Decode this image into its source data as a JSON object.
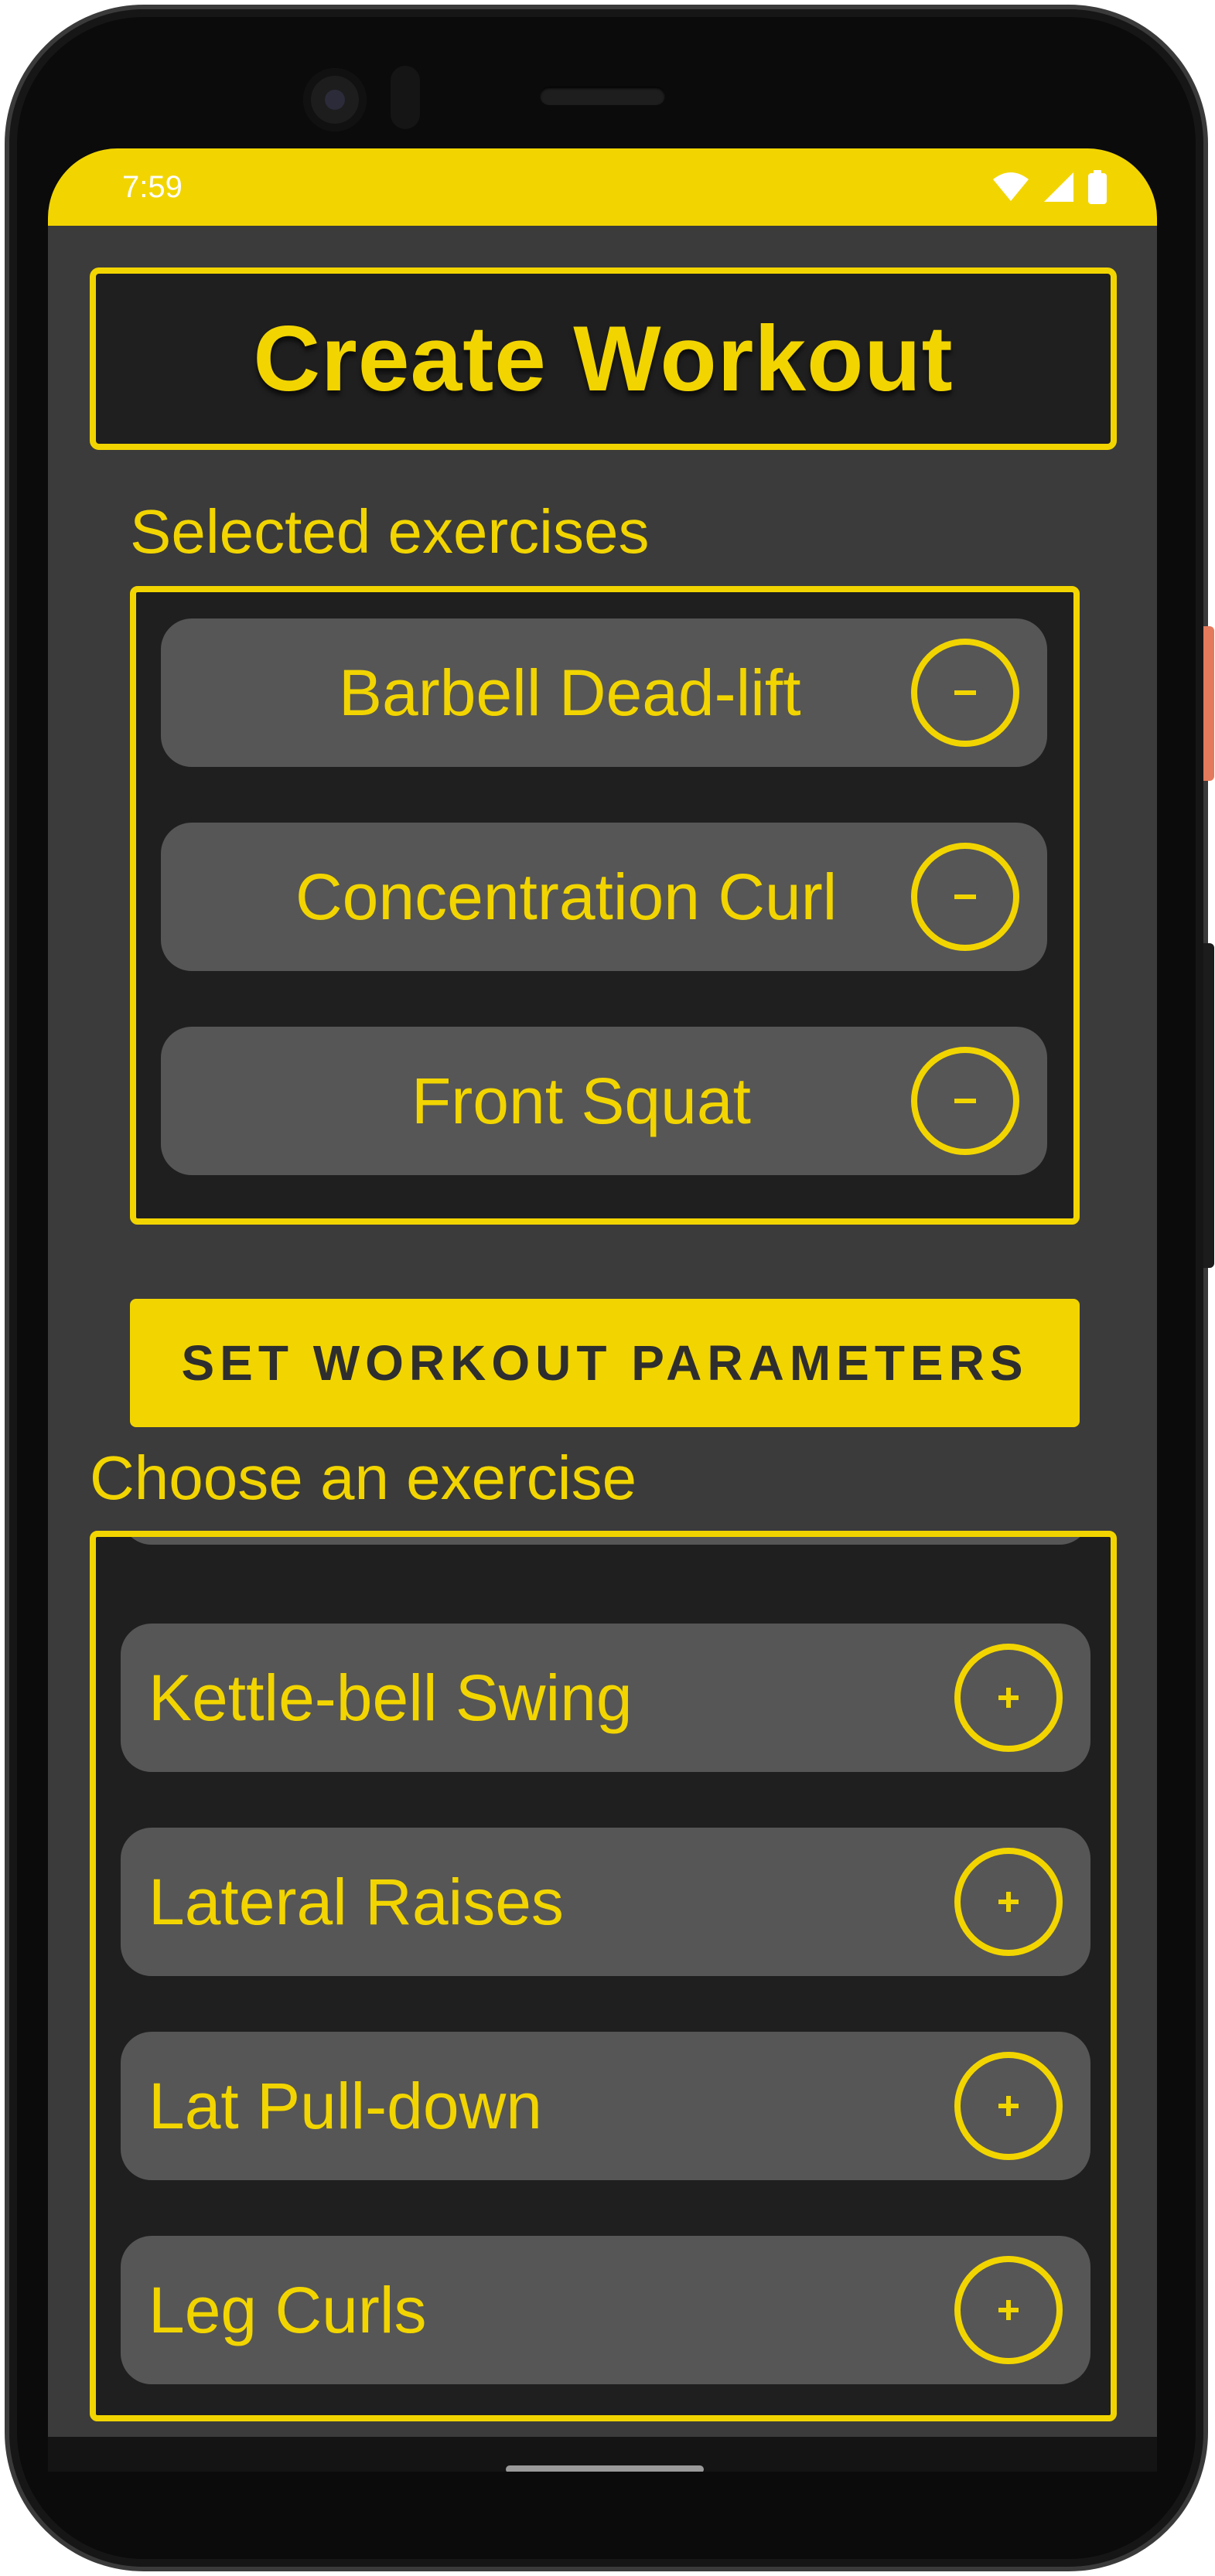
{
  "status_bar": {
    "time": "7:59",
    "icons": [
      "wifi-icon",
      "cellular-signal-icon",
      "battery-icon"
    ]
  },
  "header": {
    "title": "Create Workout"
  },
  "selected_section": {
    "label": "Selected exercises",
    "items": [
      {
        "label": "Barbell Dead-lift",
        "action_icon": "minus-icon"
      },
      {
        "label": "Concentration Curl",
        "action_icon": "minus-icon"
      },
      {
        "label": "Front Squat",
        "action_icon": "minus-icon"
      }
    ]
  },
  "set_parameters_button": {
    "label": "SET WORKOUT PARAMETERS"
  },
  "choose_section": {
    "label": "Choose an exercise",
    "items": [
      {
        "label": "Kettle-bell Swing",
        "action_icon": "plus-icon"
      },
      {
        "label": "Lateral Raises",
        "action_icon": "plus-icon"
      },
      {
        "label": "Lat Pull-down",
        "action_icon": "plus-icon"
      },
      {
        "label": "Leg Curls",
        "action_icon": "plus-icon"
      }
    ]
  },
  "colors": {
    "accent": "#f2d500",
    "background": "#3b3b3b",
    "list_background": "#1f1f1f",
    "item_background": "#565656"
  }
}
